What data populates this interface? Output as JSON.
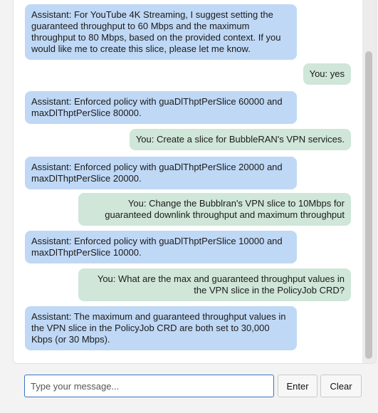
{
  "messages": [
    {
      "role": "assistant",
      "text": "Assistant: For YouTube 4K Streaming, I suggest setting the guaranteed throughput to 60 Mbps and the maximum throughput to 80 Mbps, based on the provided context. If you would like me to create this slice, please let me know."
    },
    {
      "role": "user",
      "text": "You: yes"
    },
    {
      "role": "assistant",
      "text": "Assistant: Enforced policy with guaDlThptPerSlice 60000 and maxDlThptPerSlice 80000."
    },
    {
      "role": "user",
      "text": "You: Create a slice for BubbleRAN's VPN services."
    },
    {
      "role": "assistant",
      "text": "Assistant: Enforced policy with guaDlThptPerSlice 20000 and maxDlThptPerSlice 20000."
    },
    {
      "role": "user",
      "text": "You: Change the Bubblran's VPN slice to 10Mbps for guaranteed downlink throughput and maximum throughput"
    },
    {
      "role": "assistant",
      "text": "Assistant: Enforced policy with guaDlThptPerSlice 10000 and maxDlThptPerSlice 10000."
    },
    {
      "role": "user",
      "text": "You: What are the max and guaranteed throughput values in the VPN slice in the PolicyJob CRD?"
    },
    {
      "role": "assistant",
      "text": "Assistant: The maximum and guaranteed throughput values in the VPN slice in the PolicyJob CRD are both set to 30,000 Kbps (or 30 Mbps)."
    }
  ],
  "input": {
    "placeholder": "Type your message...",
    "value": ""
  },
  "buttons": {
    "enter": "Enter",
    "clear": "Clear"
  },
  "colors": {
    "assistant_bubble": "#bfd8f5",
    "user_bubble": "#cfe6d8",
    "input_border": "#3b73c6"
  }
}
